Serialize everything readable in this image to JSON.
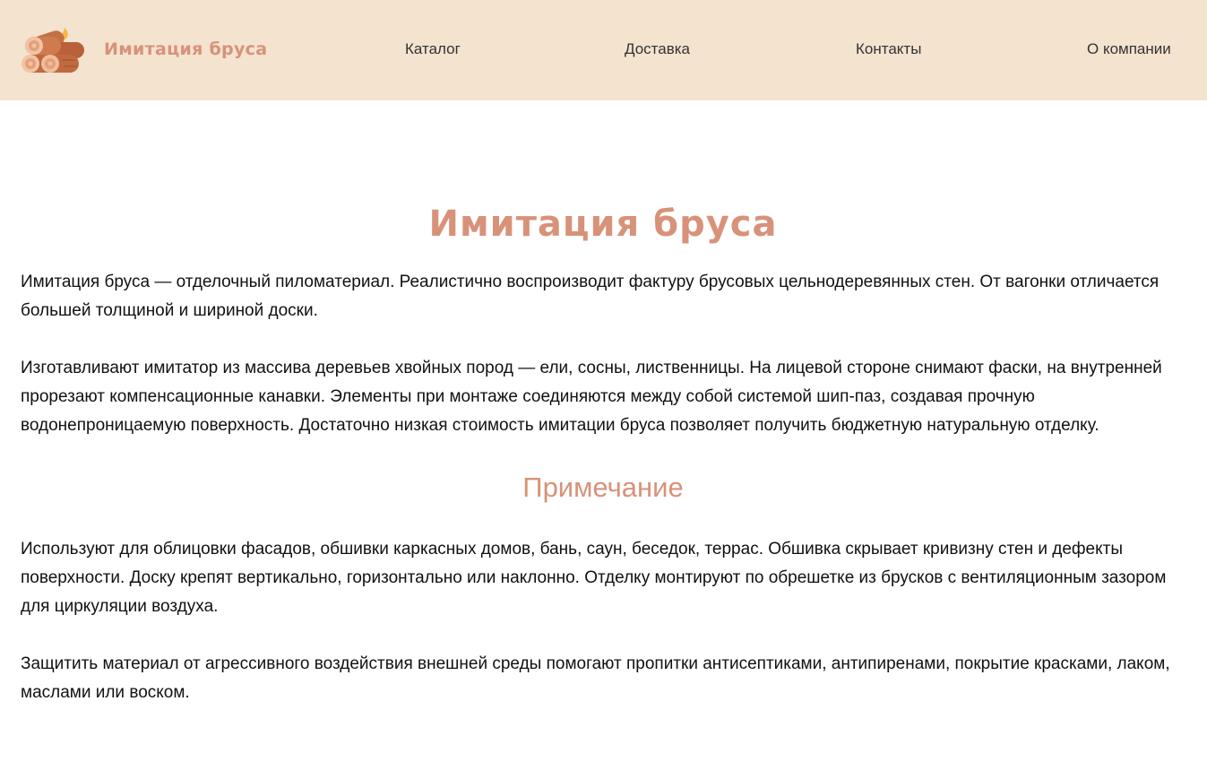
{
  "header": {
    "brand": "Имитация бруса",
    "logo_icon": "wood-logs-icon",
    "background": "#f4e3cf",
    "accent": "#d8927a",
    "nav": [
      {
        "label": "Каталог"
      },
      {
        "label": "Доставка"
      },
      {
        "label": "Контакты"
      },
      {
        "label": "О компании"
      }
    ]
  },
  "main": {
    "title": "Имитация бруса",
    "paragraphs": [
      "Имитация бруса — отделочный пиломатериал. Реалистично воспроизводит фактуру брусовых цельнодеревянных стен. От вагонки отличается большей толщиной и шириной доски.",
      "Изготавливают имитатор из массива деревьев хвойных пород — ели, сосны, лиственницы. На лицевой стороне снимают фаски, на внутренней прорезают компенсационные канавки. Элементы при монтаже соединяются между собой системой шип-паз, создавая прочную водонепроницаемую поверхность. Достаточно низкая стоимость имитации бруса позволяет получить бюджетную натуральную отделку."
    ],
    "subtitle": "Примечание",
    "note_paragraphs": [
      "Используют для облицовки фасадов, обшивки каркасных домов, бань, саун, беседок, террас. Обшивка скрывает кривизну стен и дефекты поверхности. Доску крепят вертикально, горизонтально или наклонно. Отделку монтируют по обрешетке из брусков с вентиляционным зазором для циркуляции воздуха.",
      "Защитить материал от агрессивного воздействия внешней среды помогают пропитки антисептиками, антипиренами, покрытие красками, лаком, маслами или воском."
    ]
  }
}
